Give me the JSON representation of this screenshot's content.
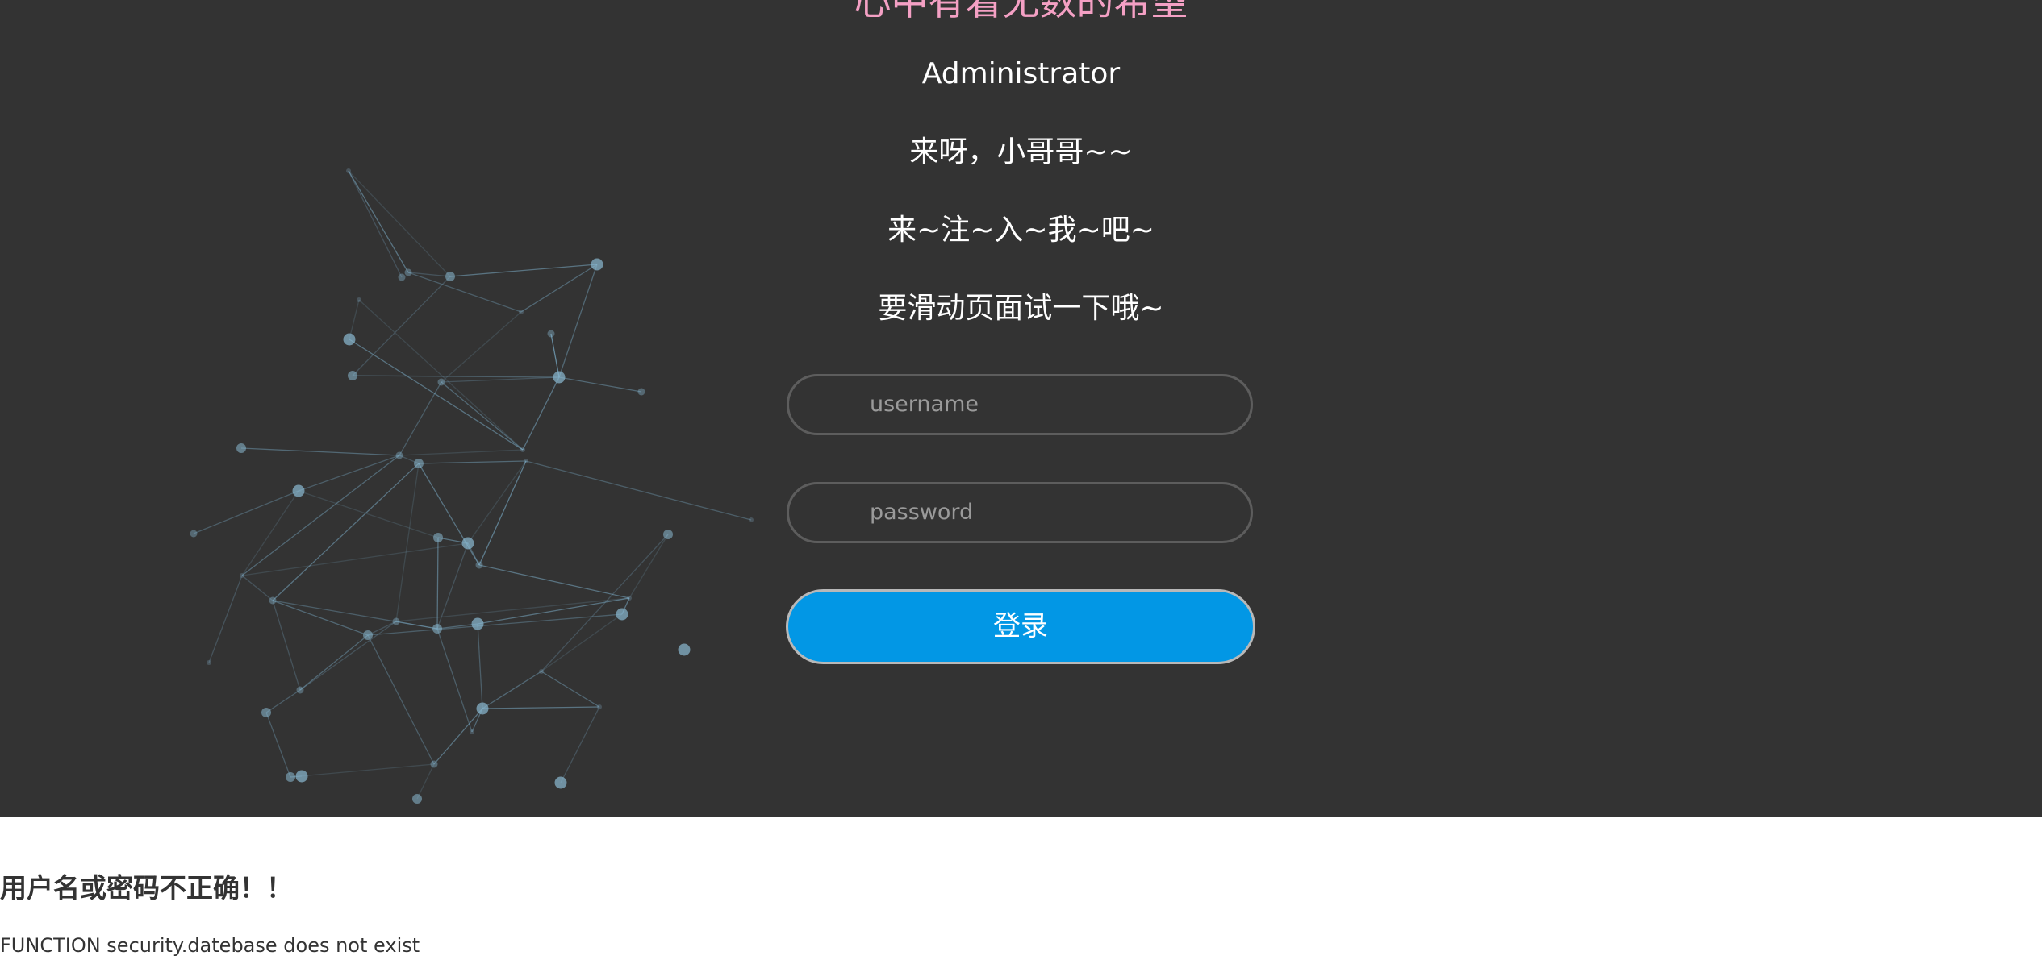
{
  "hero": {
    "slogan": "心中有着无数的希望",
    "admin": "Administrator",
    "line1": "来呀，小哥哥~~",
    "line2": "来~注~入~我~吧~",
    "line3": "要滑动页面试一下哦~"
  },
  "form": {
    "username_placeholder": "username",
    "password_placeholder": "password",
    "login_label": "登录"
  },
  "result": {
    "error": "用户名或密码不正确！！",
    "sql_error": "FUNCTION security.datebase does not exist"
  },
  "colors": {
    "background": "#333333",
    "slogan": "#f4a0c4",
    "button": "#0297e5"
  }
}
